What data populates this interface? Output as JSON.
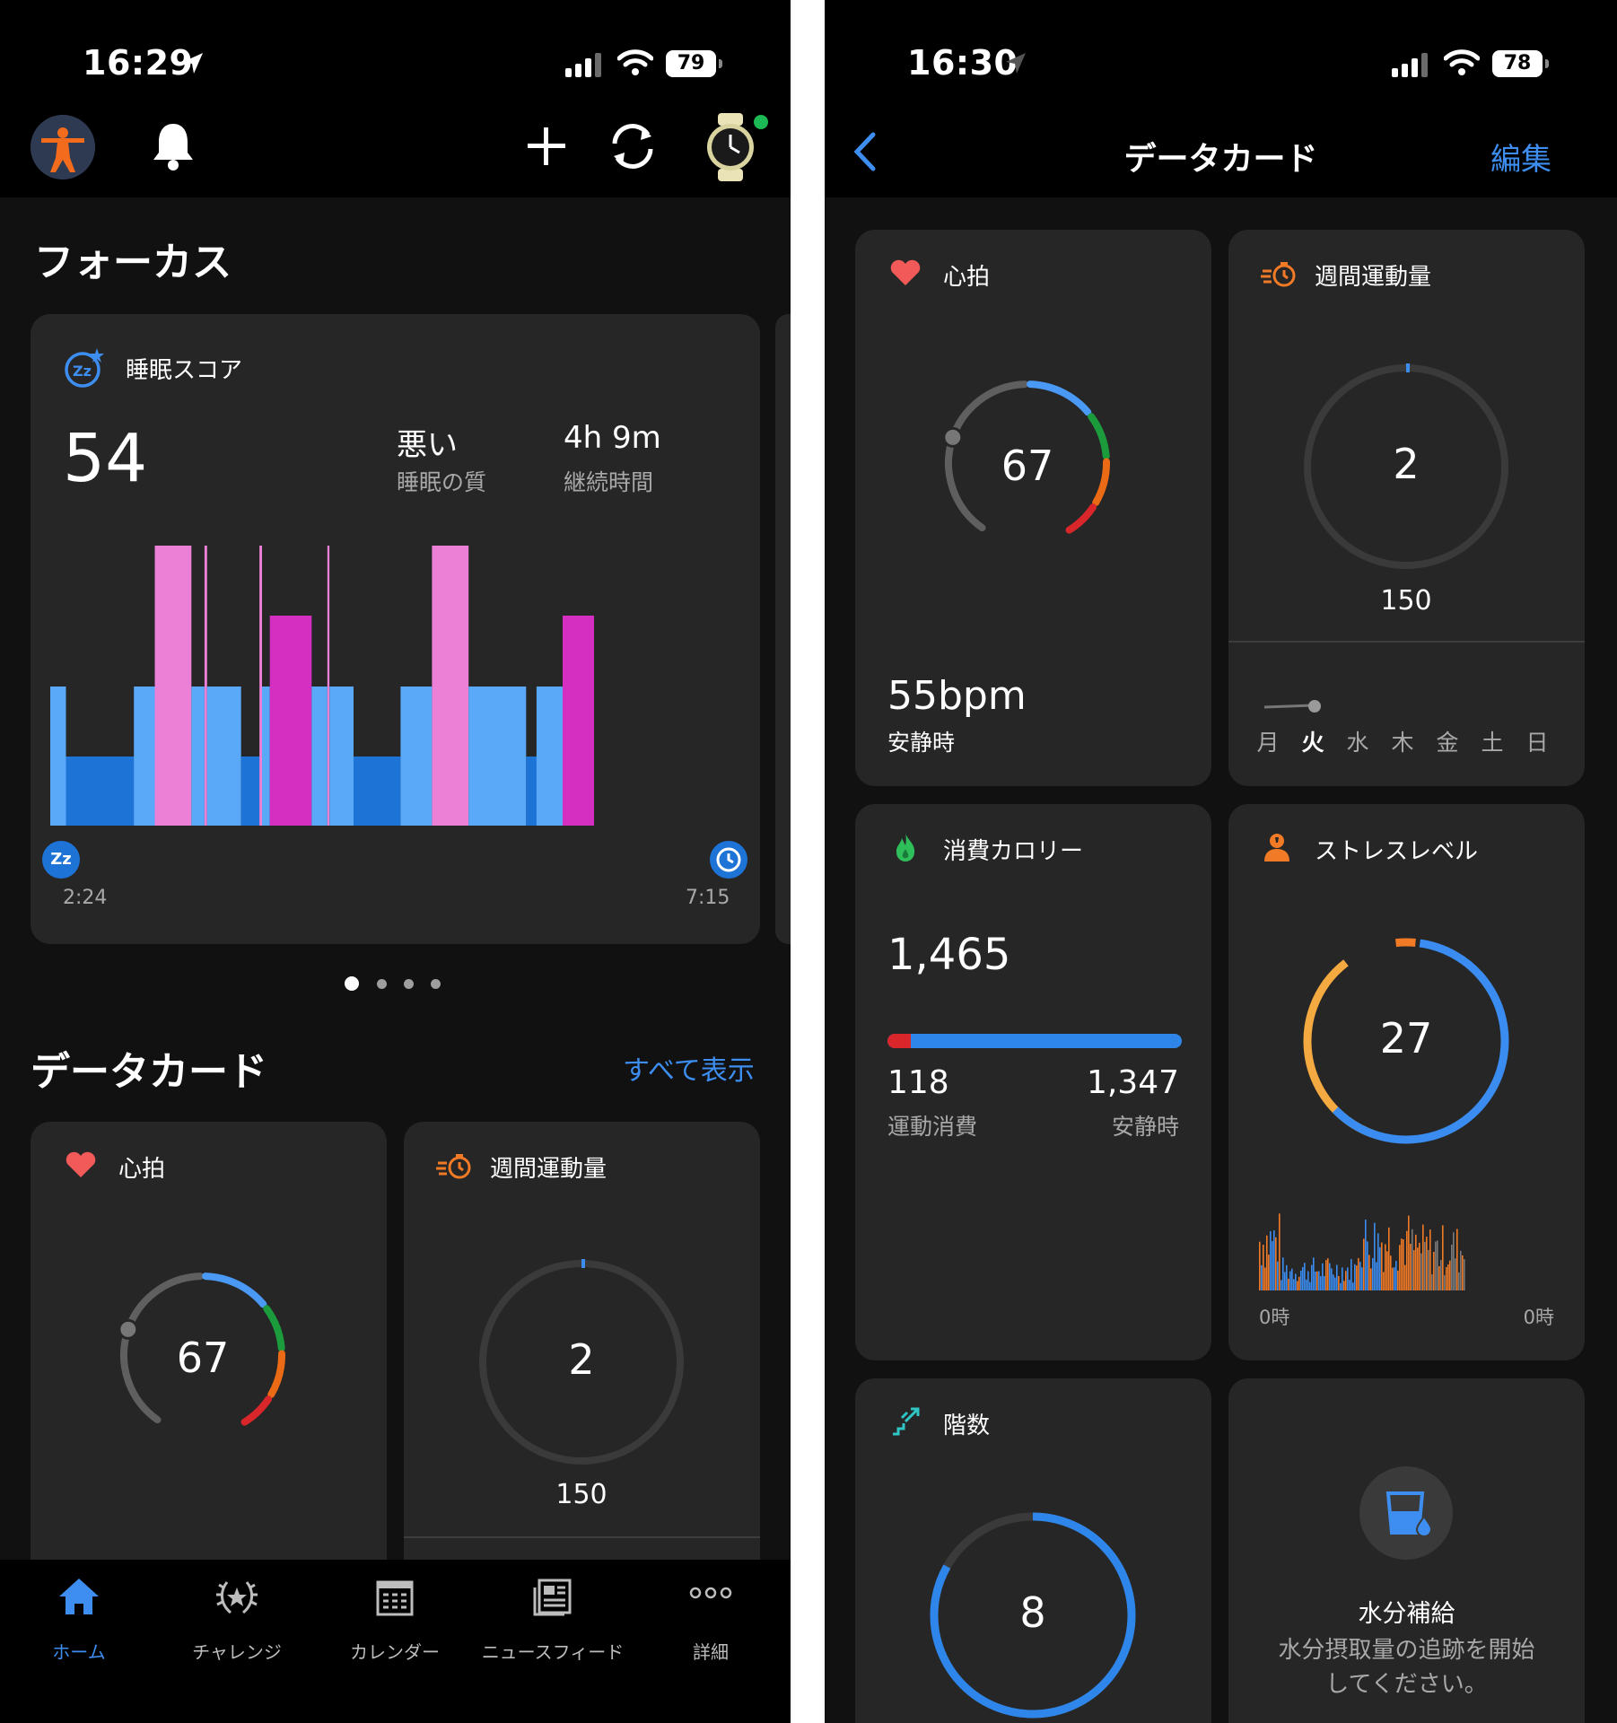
{
  "left": {
    "status": {
      "time": "16:29",
      "battery": "79"
    },
    "focus_title": "フォーカス",
    "sleep_card": {
      "title": "睡眠スコア",
      "score": "54",
      "quality_value": "悪い",
      "quality_label": "睡眠の質",
      "duration_value": "4h 9m",
      "duration_label": "継続時間",
      "start_time": "2:24",
      "end_time": "7:15",
      "start_icon_text": "Zz"
    },
    "datacards_title": "データカード",
    "show_all": "すべて表示",
    "heart_card": {
      "title": "心拍",
      "value": "67"
    },
    "weekly_card": {
      "title": "週間運動量",
      "value": "2",
      "goal": "150"
    },
    "tabs": [
      {
        "label": "ホーム",
        "icon": "home-icon"
      },
      {
        "label": "チャレンジ",
        "icon": "laurel-icon"
      },
      {
        "label": "カレンダー",
        "icon": "calendar-icon"
      },
      {
        "label": "ニュースフィード",
        "icon": "newsfeed-icon"
      },
      {
        "label": "詳細",
        "icon": "more-icon"
      }
    ]
  },
  "right": {
    "status": {
      "time": "16:30",
      "battery": "78"
    },
    "nav": {
      "title": "データカード",
      "edit": "編集"
    },
    "heart_card": {
      "title": "心拍",
      "value": "67",
      "resting_value": "55bpm",
      "resting_label": "安静時"
    },
    "weekly_card": {
      "title": "週間運動量",
      "value": "2",
      "goal": "150",
      "days": [
        "月",
        "火",
        "水",
        "木",
        "金",
        "土",
        "日"
      ],
      "current_day": "火"
    },
    "calories_card": {
      "title": "消費カロリー",
      "total": "1,465",
      "active_value": "118",
      "active_label": "運動消費",
      "resting_value": "1,347",
      "resting_label": "安静時"
    },
    "stress_card": {
      "title": "ストレスレベル",
      "value": "27",
      "start_label": "0時",
      "end_label": "0時"
    },
    "floors_card": {
      "title": "階数",
      "value": "8"
    },
    "hydration_card": {
      "title": "水分補給",
      "message_line1": "水分摂取量の追跡を開始",
      "message_line2": "してください。"
    }
  },
  "colors": {
    "accent_blue": "#3d8ef0",
    "deep_sleep": "#1e74d6",
    "light_sleep": "#5aa9f8",
    "rem": "#ec7fd6",
    "awake": "#d42fc1",
    "hr_gray": "#5f5f5f",
    "hr_blue": "#4a9af5",
    "hr_green": "#1c9b3c",
    "hr_orange": "#ea6a16",
    "hr_red": "#d9262a",
    "stress_orange": "#f5a941",
    "stress_blue": "#3a8cf0",
    "card_bg": "#262626"
  },
  "sleep_stages": [
    {
      "stage": "light",
      "from": 0,
      "to": 3
    },
    {
      "stage": "deep",
      "from": 3,
      "to": 16
    },
    {
      "stage": "light",
      "from": 16,
      "to": 20
    },
    {
      "stage": "rem",
      "from": 20,
      "to": 27
    },
    {
      "stage": "light",
      "from": 27,
      "to": 29.5
    },
    {
      "stage": "rem",
      "from": 29.5,
      "to": 30
    },
    {
      "stage": "light",
      "from": 30,
      "to": 36.5
    },
    {
      "stage": "deep",
      "from": 36.5,
      "to": 40
    },
    {
      "stage": "rem",
      "from": 40,
      "to": 40.5
    },
    {
      "stage": "light",
      "from": 40.5,
      "to": 42
    },
    {
      "stage": "awake",
      "from": 42,
      "to": 50
    },
    {
      "stage": "light",
      "from": 50,
      "to": 53
    },
    {
      "stage": "rem",
      "from": 53,
      "to": 53.4
    },
    {
      "stage": "light",
      "from": 53.4,
      "to": 58
    },
    {
      "stage": "deep",
      "from": 58,
      "to": 67
    },
    {
      "stage": "light",
      "from": 67,
      "to": 73
    },
    {
      "stage": "rem",
      "from": 73,
      "to": 80
    },
    {
      "stage": "light",
      "from": 80,
      "to": 91
    },
    {
      "stage": "deep",
      "from": 91,
      "to": 93
    },
    {
      "stage": "light",
      "from": 93,
      "to": 98
    },
    {
      "stage": "awake",
      "from": 98,
      "to": 104
    }
  ]
}
